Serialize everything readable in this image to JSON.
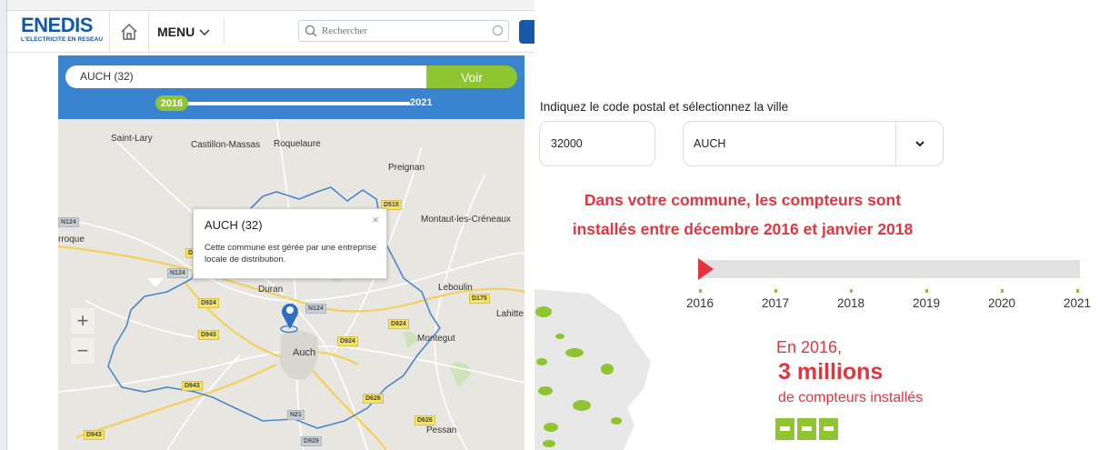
{
  "header": {
    "logo_text": "ENEDIS",
    "logo_subtitle": "L'ELECTRICITE EN RESEAU",
    "menu_label": "MENU",
    "search_placeholder": "Rechercher"
  },
  "map_panel": {
    "commune_value": "AUCH (32)",
    "voir_label": "Voir",
    "slider_start": "2016",
    "slider_end": "2021",
    "popup": {
      "title": "AUCH (32)",
      "close": "×",
      "body": "Cette commune est gérée par une entreprise locale de distribution."
    },
    "zoom_in": "+",
    "zoom_out": "−",
    "places": [
      {
        "name": "Saint-Lary"
      },
      {
        "name": "Castillon-Massas"
      },
      {
        "name": "Roquelaure"
      },
      {
        "name": "Preignan"
      },
      {
        "name": "Montaut-les-Créneaux"
      },
      {
        "name": "rroque"
      },
      {
        "name": "Duran"
      },
      {
        "name": "Leboulin"
      },
      {
        "name": "Lahitte"
      },
      {
        "name": "Montegut"
      },
      {
        "name": "Auch"
      },
      {
        "name": "Pessan"
      }
    ],
    "roads": [
      "D515",
      "N124",
      "D924",
      "D924",
      "N124",
      "D175",
      "D943",
      "D924",
      "D924",
      "D943",
      "D626",
      "N21",
      "D626",
      "D943",
      "D929",
      "N124"
    ]
  },
  "right_panel": {
    "instruction": "Indiquez le code postal et sélectionnez la ville",
    "postal_code": "32000",
    "city": "AUCH",
    "headline_line1": "Dans votre commune, les compteurs sont",
    "headline_line2": "installés entre décembre 2016 et janvier 2018",
    "timeline_years": [
      "2016",
      "2017",
      "2018",
      "2019",
      "2020",
      "2021"
    ],
    "stat_line1": "En 2016,",
    "stat_big": "3 millions",
    "stat_line3": "de compteurs installés"
  },
  "colors": {
    "brand_blue": "#1657a8",
    "map_header_blue": "#3a84cf",
    "accent_green": "#8ec530",
    "accent_red": "#e2353f"
  }
}
